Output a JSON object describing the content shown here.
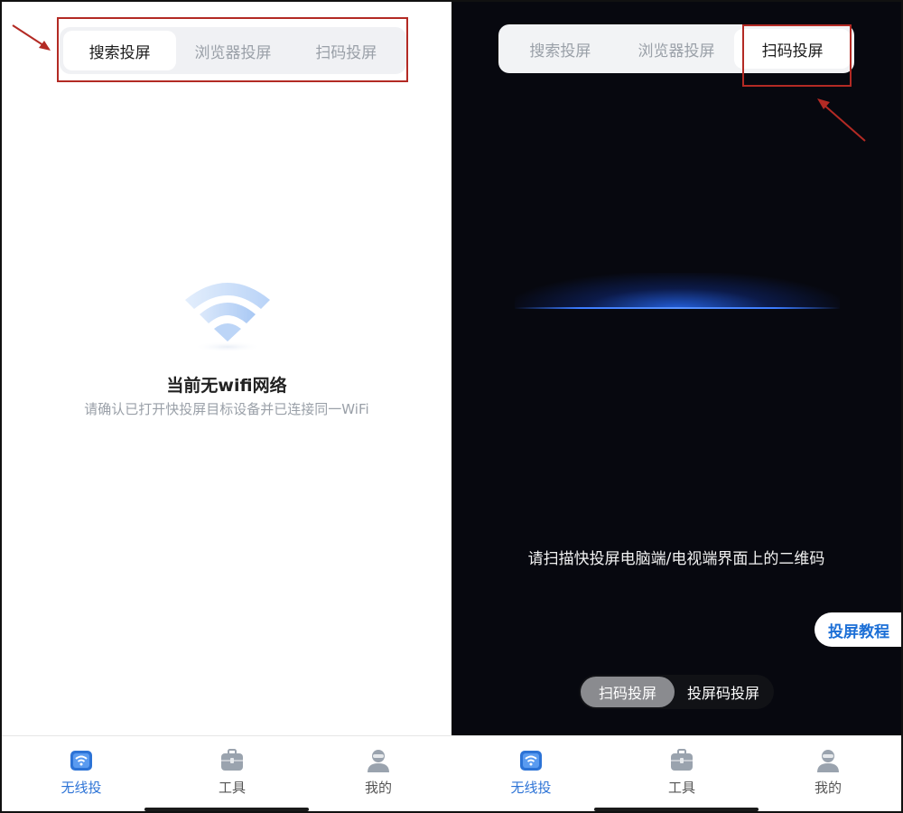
{
  "left_screen": {
    "tabs": [
      {
        "label": "搜索投屏",
        "active": true
      },
      {
        "label": "浏览器投屏",
        "active": false
      },
      {
        "label": "扫码投屏",
        "active": false
      }
    ],
    "empty_state": {
      "icon": "wifi-icon",
      "title": "当前无wifi网络",
      "subtitle": "请确认已打开快投屏目标设备并已连接同一WiFi"
    }
  },
  "right_screen": {
    "tabs": [
      {
        "label": "搜索投屏",
        "active": false
      },
      {
        "label": "浏览器投屏",
        "active": false
      },
      {
        "label": "扫码投屏",
        "active": true
      }
    ],
    "scan_hint": "请扫描快投屏电脑端/电视端界面上的二维码",
    "tutorial_button": "投屏教程",
    "mode_switch": [
      {
        "label": "扫码投屏",
        "active": true
      },
      {
        "label": "投屏码投屏",
        "active": false
      }
    ]
  },
  "bottom_nav": [
    {
      "label": "无线投",
      "icon": "cast-wifi-icon",
      "active": true
    },
    {
      "label": "工具",
      "icon": "toolbox-icon",
      "active": false
    },
    {
      "label": "我的",
      "icon": "user-icon",
      "active": false
    }
  ],
  "colors": {
    "accent": "#2c73d6",
    "annotation": "#b32a24",
    "dark_bg": "#07080f",
    "scan_blue": "#3b7bff"
  }
}
